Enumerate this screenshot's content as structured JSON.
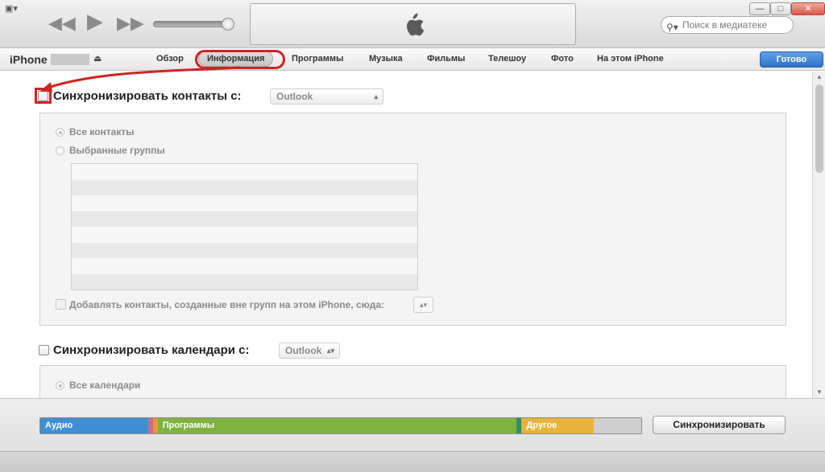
{
  "window": {
    "menu_icon": "sidebar-menu-icon",
    "controls": {
      "rewind": "◀◀",
      "play": "▶",
      "forward": "▶▶"
    },
    "search_placeholder": "Поиск в медиатеке",
    "window_buttons": {
      "minimize": "—",
      "maximize": "□",
      "close": "✕"
    }
  },
  "nav": {
    "device": "iPhone",
    "tabs": [
      {
        "label": "Обзор"
      },
      {
        "label": "Информация",
        "active": true
      },
      {
        "label": "Программы"
      },
      {
        "label": "Музыка"
      },
      {
        "label": "Фильмы"
      },
      {
        "label": "Телешоу"
      },
      {
        "label": "Фото"
      },
      {
        "label": "На этом iPhone"
      }
    ],
    "done_label": "Готово"
  },
  "contacts": {
    "title": "Синхронизировать контакты с:",
    "source": "Outlook",
    "option_all": "Все контакты",
    "option_selected": "Выбранные группы",
    "add_label": "Добавлять контакты, созданные вне групп на этом iPhone, сюда:"
  },
  "calendars": {
    "title": "Синхронизировать календари с:",
    "source": "Outlook",
    "option_all": "Все календари"
  },
  "capacity": {
    "segments": [
      {
        "label": "Аудио",
        "color": "#3f8fd4",
        "fraction": 0.18
      },
      {
        "label": "",
        "color": "#d06a8c",
        "fraction": 0.006
      },
      {
        "label": "",
        "color": "#e09a3c",
        "fraction": 0.006
      },
      {
        "label": "Программы",
        "color": "#7fb23f",
        "fraction": 0.6
      },
      {
        "label": "",
        "color": "#2e8f6a",
        "fraction": 0.008
      },
      {
        "label": "Другое",
        "color": "#e8b33c",
        "fraction": 0.12
      },
      {
        "label": "",
        "color": "#cfcfcf",
        "fraction": 0.08
      }
    ]
  },
  "sync_label": "Синхронизировать",
  "accent": {
    "highlight": "#cf2424",
    "done_blue": "#2f72c8"
  }
}
